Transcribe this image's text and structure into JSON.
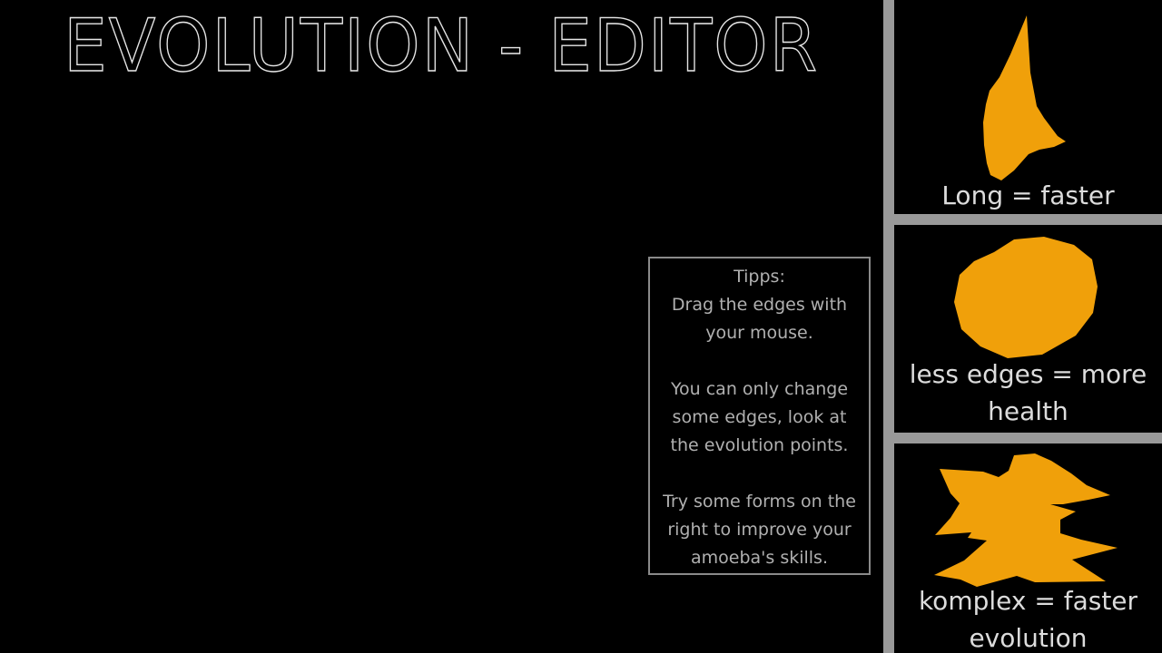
{
  "title": "EVOLUTION - EDITOR",
  "colors": {
    "background": "#000000",
    "divider": "#999999",
    "shape": "#f0a00a",
    "label": "#dcdcdc",
    "tips_text": "#b0b0b0",
    "tips_border": "#8a8a8a"
  },
  "tips": {
    "heading": "Tipps:",
    "lines": [
      "Drag the edges with",
      "your mouse.",
      "",
      "You can only change",
      "some edges, look at",
      "the evolution points.",
      "",
      "Try some forms on the",
      "right to improve your",
      "amoeba's skills."
    ]
  },
  "presets": [
    {
      "label": "Long = faster",
      "shape": "long"
    },
    {
      "label_line1": "less edges = more",
      "label_line2": "health",
      "shape": "round"
    },
    {
      "label_line1": "komplex = faster",
      "label_line2": "evolution",
      "shape": "complex"
    }
  ]
}
